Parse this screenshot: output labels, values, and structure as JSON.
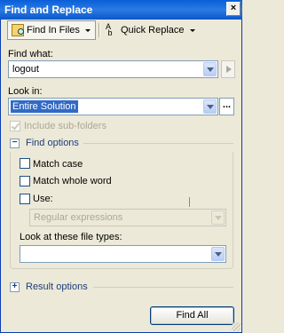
{
  "window": {
    "title": "Find and Replace",
    "close_glyph": "×"
  },
  "toolbar": {
    "find_in_files": {
      "label": "Find In Files",
      "icon": "find-in-files-icon"
    },
    "quick_replace": {
      "label": "Quick Replace",
      "icon": "quick-replace-icon"
    }
  },
  "find_what": {
    "label": "Find what:",
    "value": "logout"
  },
  "look_in": {
    "label": "Look in:",
    "value": "Entire Solution",
    "browse_label": "..."
  },
  "include_subfolders": {
    "label": "Include sub-folders",
    "checked": true,
    "enabled": false
  },
  "find_options": {
    "title": "Find options",
    "expander": "−",
    "match_case": {
      "label": "Match case",
      "checked": false
    },
    "match_whole_word": {
      "label": "Match whole word",
      "checked": false
    },
    "use": {
      "label": "Use:",
      "checked": false
    },
    "use_type": {
      "value": "Regular expressions",
      "enabled": false
    },
    "file_types": {
      "label": "Look at these file types:",
      "value": ""
    }
  },
  "result_options": {
    "title": "Result options",
    "expander": "+"
  },
  "buttons": {
    "find_all": "Find All"
  },
  "colors": {
    "titlebar": "#0a5fd8",
    "window_bg": "#ece9d8",
    "selection": "#316ac5"
  }
}
